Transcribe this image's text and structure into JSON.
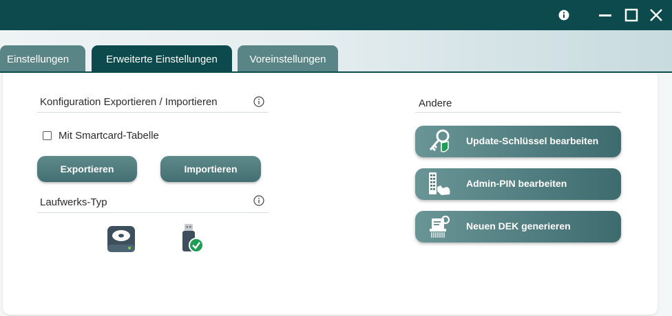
{
  "window": {
    "controls": [
      "info-icon",
      "minimize-icon",
      "maximize-icon",
      "close-icon"
    ],
    "colors": {
      "titlebar": "#0d4a4d",
      "accent": "#426f71",
      "check_badge": "#1f9d55"
    }
  },
  "tabs": [
    {
      "label": "Einstellungen",
      "active": false
    },
    {
      "label": "Erweiterte Einstellungen",
      "active": true
    },
    {
      "label": "Voreinstellungen",
      "active": false
    }
  ],
  "config": {
    "heading": "Konfiguration Exportieren / Importieren",
    "heading_icon": "info-icon",
    "checkbox_label": "Mit Smartcard-Tabelle",
    "checkbox_checked": false,
    "export_label": "Exportieren",
    "import_label": "Importieren"
  },
  "drive": {
    "heading": "Laufwerks-Typ",
    "heading_icon": "info-icon",
    "options": [
      {
        "icon": "hard-drive-icon"
      },
      {
        "icon": "usb-drive-icon",
        "selected": true
      }
    ]
  },
  "other": {
    "heading": "Andere",
    "buttons": [
      {
        "label": "Update-Schlüssel bearbeiten",
        "icon": "key-shield-icon"
      },
      {
        "label": "Admin-PIN bearbeiten",
        "icon": "keypad-hand-icon"
      },
      {
        "label": "Neuen DEK generieren",
        "icon": "key-shredder-icon"
      }
    ]
  }
}
